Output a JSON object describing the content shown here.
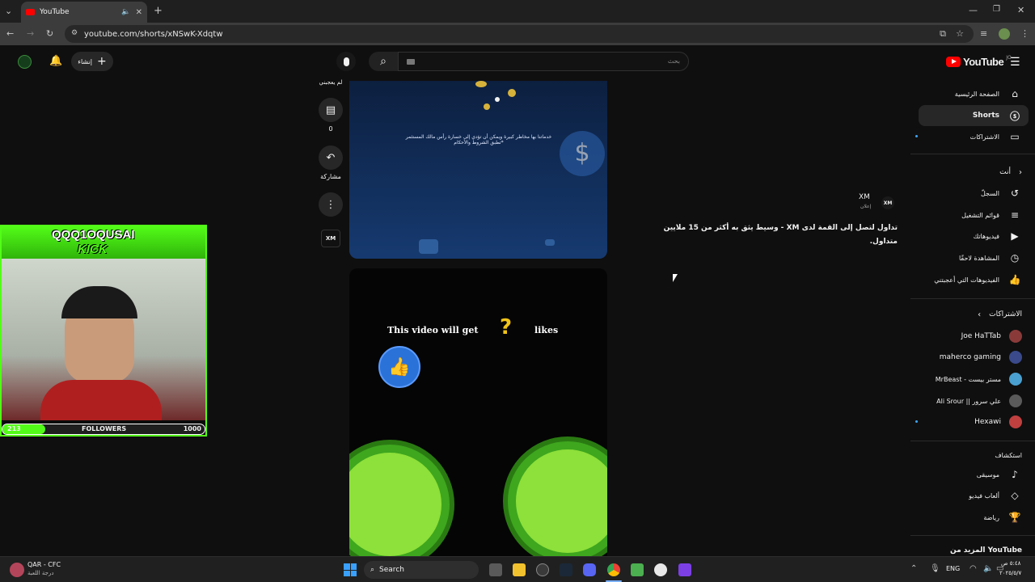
{
  "browser": {
    "tab_title": "YouTube",
    "url": "youtube.com/shorts/xNSwK-Xdqtw"
  },
  "header": {
    "logo_text": "YouTube",
    "logo_region": "JO",
    "search_placeholder": "بحث",
    "create_label": "إنشاء"
  },
  "sidebar": {
    "main": [
      {
        "label": "الصفحة الرئيسية",
        "icon": "home-icon"
      },
      {
        "label": "Shorts",
        "icon": "shorts-icon"
      },
      {
        "label": "الاشتراكات",
        "icon": "subscriptions-icon"
      }
    ],
    "you_heading": "أنت",
    "you_items": [
      {
        "label": "السجلّ",
        "icon": "history-icon"
      },
      {
        "label": "قوائم التشغيل",
        "icon": "playlist-icon"
      },
      {
        "label": "فيديوهاتك",
        "icon": "your-videos-icon"
      },
      {
        "label": "المشاهدة لاحقًا",
        "icon": "watch-later-icon"
      },
      {
        "label": "الفيديوهات التي أعجبتني",
        "icon": "liked-icon"
      }
    ],
    "subs_heading": "الاشتراكات",
    "subs": [
      {
        "label": "Joe HaTTab",
        "color": "#8b3a3a"
      },
      {
        "label": "maherco gaming",
        "color": "#3a4a8b"
      },
      {
        "label": "MrBeast - مستر بيست",
        "color": "#4aa0d0"
      },
      {
        "label": "Ali Srour || علي سرور",
        "color": "#5a5a5a"
      },
      {
        "label": "Hexawi",
        "color": "#c04040"
      }
    ],
    "explore_heading": "استكشاف",
    "explore": [
      {
        "label": "موسيقى",
        "icon": "music-icon"
      },
      {
        "label": "ألعاب فيديو",
        "icon": "gaming-icon"
      },
      {
        "label": "رياضة",
        "icon": "trophy-icon"
      }
    ],
    "more_heading": "المزيد من YouTube"
  },
  "short": {
    "ad_top_text_1": "خدماتنا بها مخاطر كبيرة ويمكن أن تؤدي إلى خسارة رأس مالك المستثمر",
    "ad_top_text_2": "*تطبق الشروط والأحكام",
    "advertiser": "XM",
    "ad_badge": "إعلان",
    "ad_title": "تداول لتصل إلى القمة لدى XM - وسيط يثق به أكثر من 15 ملايين متداول.",
    "dislike_label": "لم يعجبني",
    "comments_count": "0",
    "share_label": "مشاركة",
    "video_caption_left": "This video will get",
    "video_caption_right": "likes",
    "xm_logo": "XM"
  },
  "overlay": {
    "streamer_name": "QQQ1OQUSAI",
    "platform": "KICK",
    "followers_current": "213",
    "followers_label": "FOLLOWERS",
    "followers_goal": "1000",
    "followers_progress": 0.213
  },
  "taskbar": {
    "weather_title": "QAR - CFC",
    "weather_sub": "درجة اللعبة",
    "search_label": "Search",
    "lang": "ENG",
    "time": "٥:٤٨ ص",
    "date": "٢٠٢٥/٥/٧"
  }
}
